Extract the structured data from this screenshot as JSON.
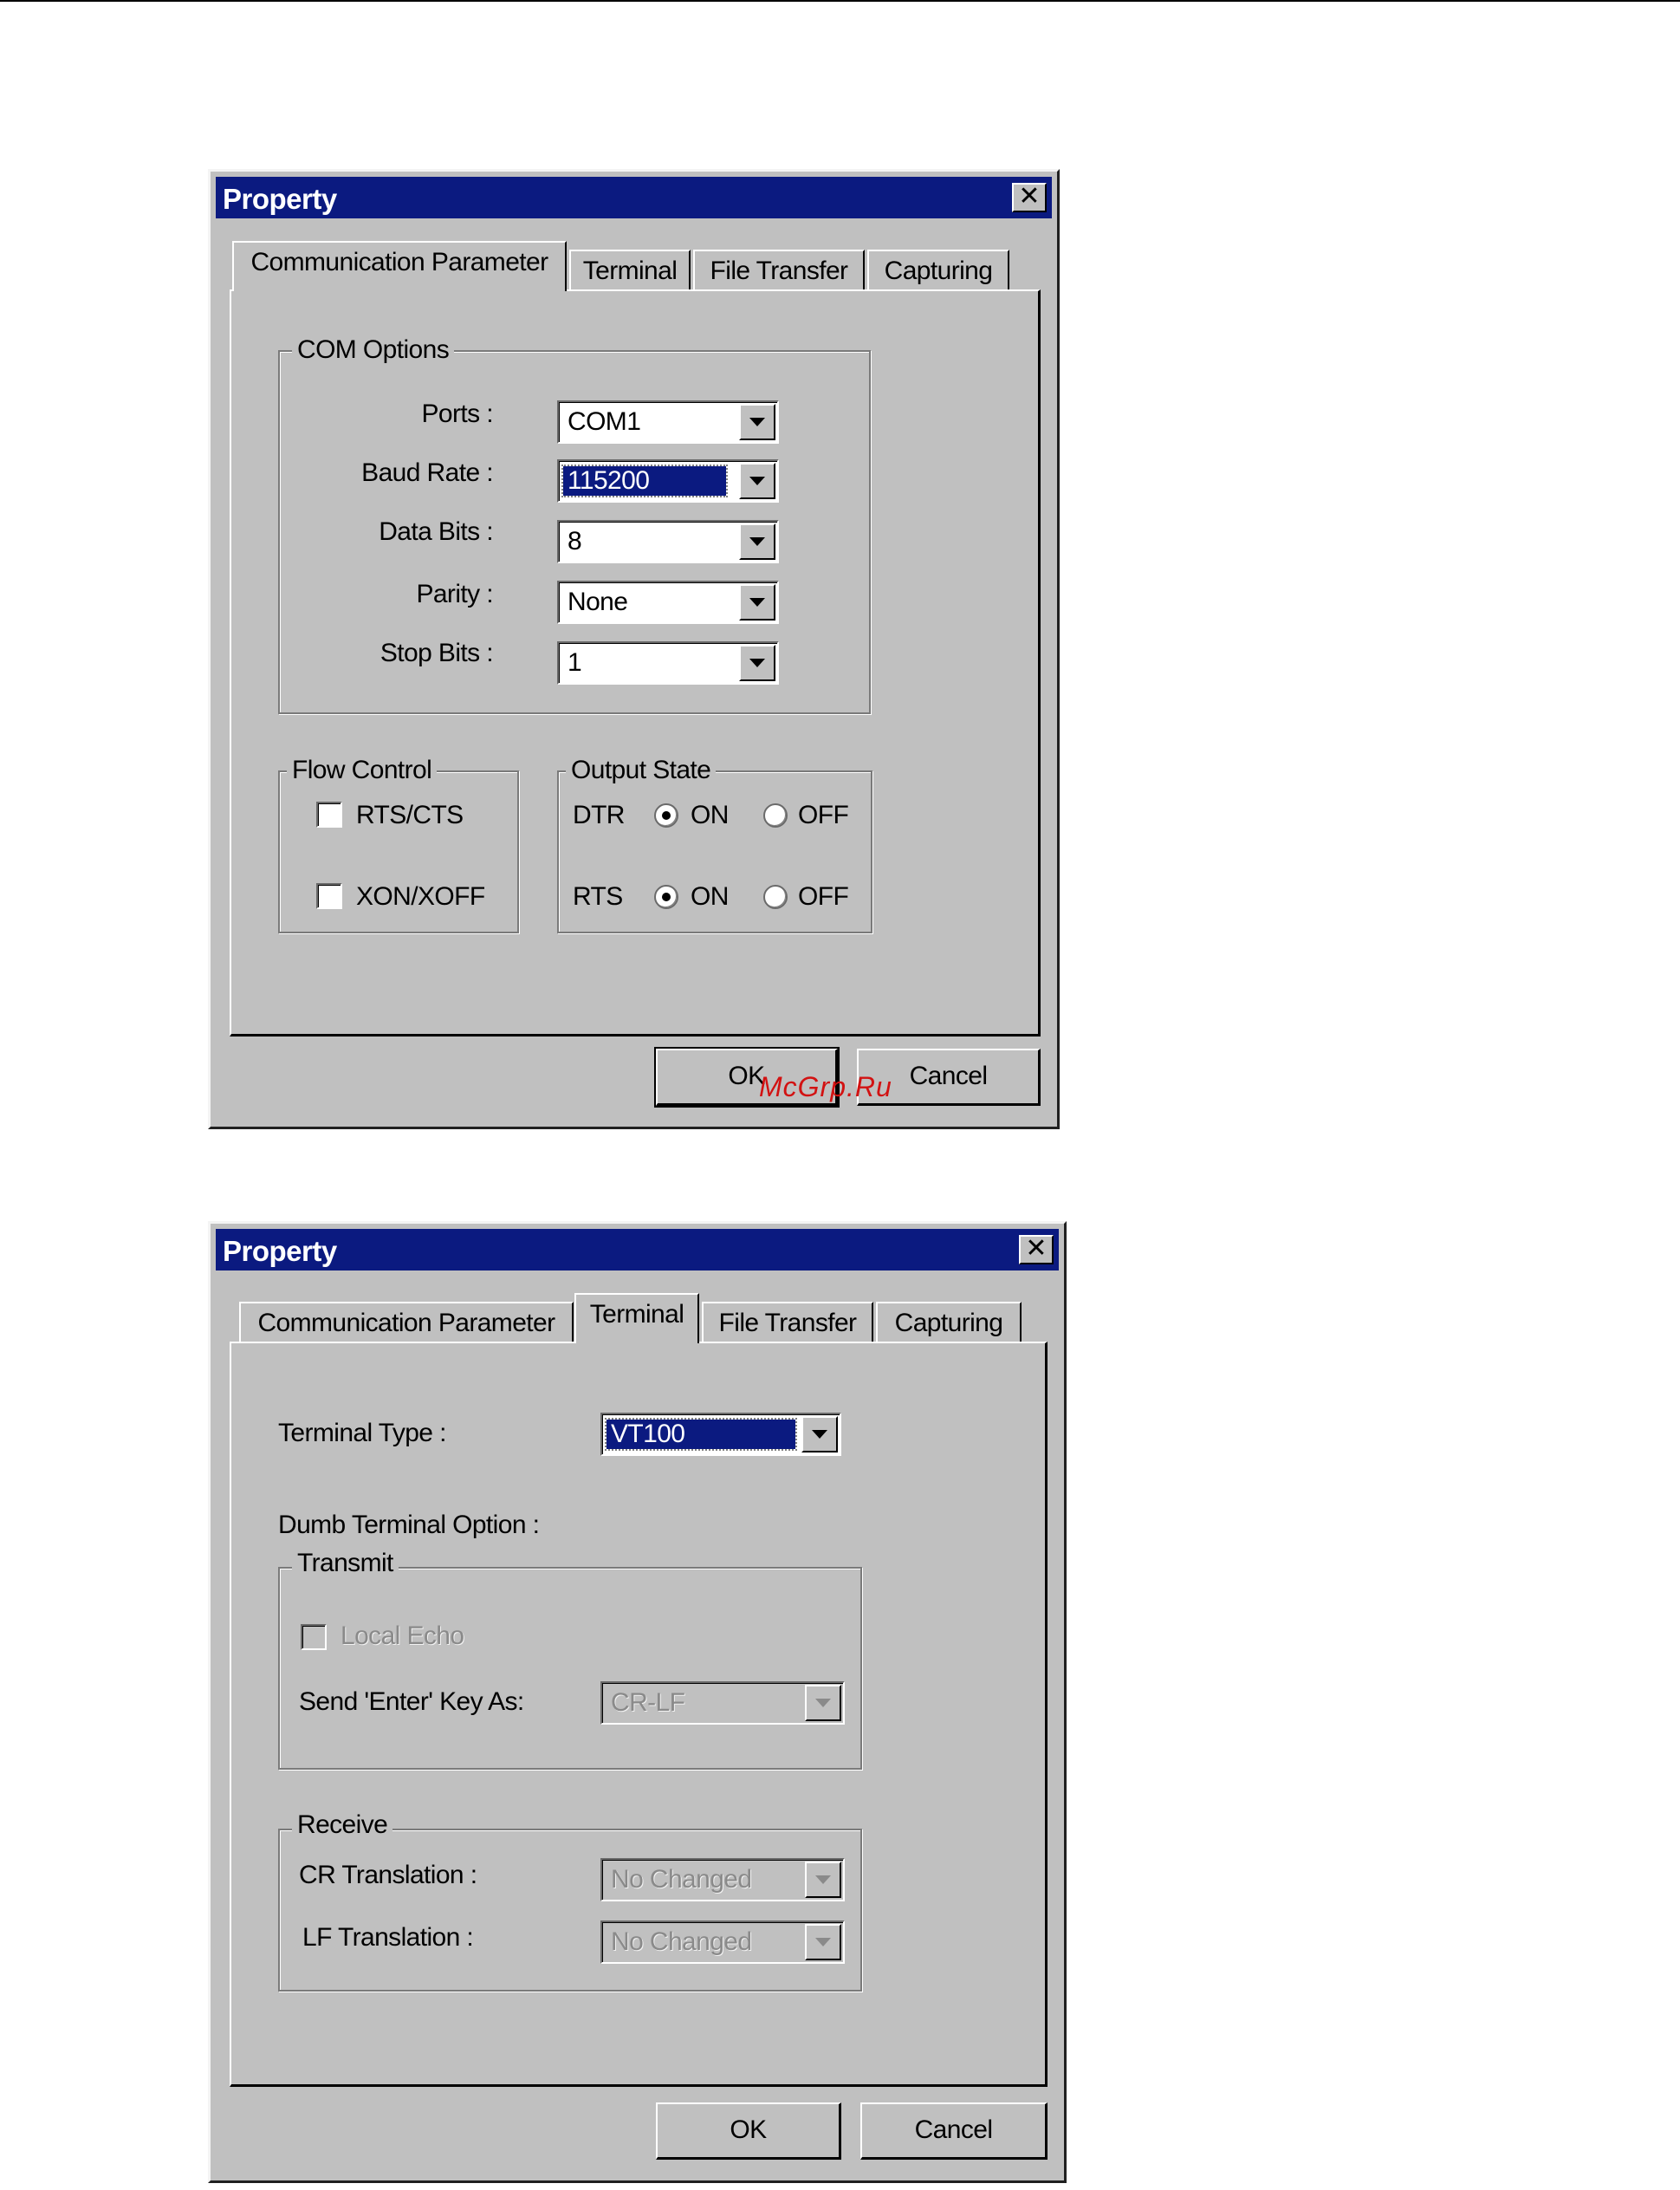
{
  "watermark": "McGrp.Ru",
  "dialog1": {
    "title": "Property",
    "tabs": [
      "Communication Parameter",
      "Terminal",
      "File Transfer",
      "Capturing"
    ],
    "active_tab": "Communication Parameter",
    "com_options": {
      "group_title": "COM Options",
      "fields": [
        {
          "label": "Ports :",
          "value": "COM1"
        },
        {
          "label": "Baud Rate :",
          "value": "115200"
        },
        {
          "label": "Data Bits :",
          "value": "8"
        },
        {
          "label": "Parity :",
          "value": "None"
        },
        {
          "label": "Stop Bits :",
          "value": "1"
        }
      ]
    },
    "flow_control": {
      "group_title": "Flow Control",
      "options": [
        {
          "label": "RTS/CTS",
          "checked": false
        },
        {
          "label": "XON/XOFF",
          "checked": false
        }
      ]
    },
    "output_state": {
      "group_title": "Output State",
      "rows": [
        {
          "label": "DTR",
          "on_label": "ON",
          "off_label": "OFF",
          "selected": "ON"
        },
        {
          "label": "RTS",
          "on_label": "ON",
          "off_label": "OFF",
          "selected": "ON"
        }
      ]
    },
    "ok_label": "OK",
    "cancel_label": "Cancel"
  },
  "dialog2": {
    "title": "Property",
    "tabs": [
      "Communication Parameter",
      "Terminal",
      "File Transfer",
      "Capturing"
    ],
    "active_tab": "Terminal",
    "terminal_type": {
      "label": "Terminal Type :",
      "value": "VT100"
    },
    "dumb_terminal_label": "Dumb Terminal Option :",
    "transmit": {
      "group_title": "Transmit",
      "local_echo_label": "Local Echo",
      "local_echo_checked": false,
      "send_enter_label": "Send 'Enter' Key As:",
      "send_enter_value": "CR-LF"
    },
    "receive": {
      "group_title": "Receive",
      "cr_label": "CR Translation :",
      "cr_value": "No Changed",
      "lf_label": "LF Translation :",
      "lf_value": "No Changed"
    },
    "ok_label": "OK",
    "cancel_label": "Cancel"
  }
}
